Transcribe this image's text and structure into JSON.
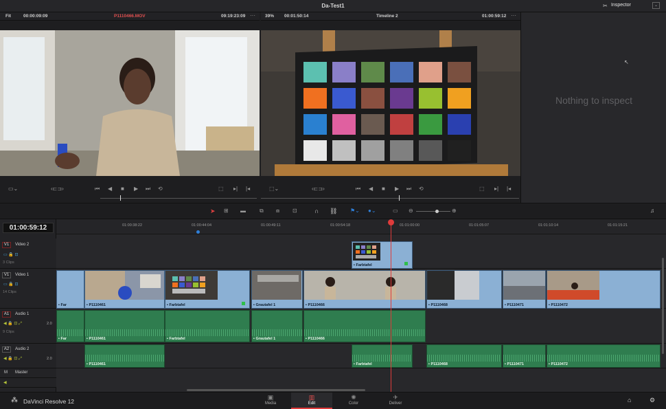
{
  "app": {
    "title": "Da-Test1",
    "inspector_label": "Inspector",
    "brand": "DaVinci Resolve 12"
  },
  "source_viewer": {
    "zoom": "Fit",
    "timecode_in": "00:00:09:09",
    "clip_name": "P1110466.MOV",
    "timecode_out": "09:19:23:09"
  },
  "timeline_viewer": {
    "zoom": "39%",
    "timecode_in": "00:01:50:14",
    "timeline_name": "Timeline 2",
    "timecode_out": "01:00:59:12"
  },
  "inspector": {
    "empty_text": "Nothing to inspect"
  },
  "timeline": {
    "current_timecode": "01:00:59:12",
    "ruler": [
      "01:00:38:22",
      "01:00:44:04",
      "01:00:49:11",
      "01:00:54:18",
      "01:01:00:00",
      "01:01:05:07",
      "01:01:10:14",
      "01:01:15:21"
    ],
    "tracks": {
      "v2": {
        "id": "V1",
        "name": "Video 2",
        "clips": "3 Clips"
      },
      "v1": {
        "id": "V1",
        "name": "Video 1",
        "clips": "14 Clips"
      },
      "a1": {
        "id": "A1",
        "name": "Audio 1",
        "clips": "9 Clips",
        "level": "2.0"
      },
      "a2": {
        "id": "A2",
        "name": "Audio 2",
        "level": "2.0"
      },
      "master": {
        "id": "M",
        "name": "Master"
      }
    },
    "video2_clips": [
      {
        "label": "Farbtafel"
      }
    ],
    "video1_clips": [
      {
        "label": "Far"
      },
      {
        "label": "P1110461"
      },
      {
        "label": "Farbtafel"
      },
      {
        "label": "Grautafel 1"
      },
      {
        "label": "P1110466"
      },
      {
        "label": "P1110468"
      },
      {
        "label": "P1110471"
      },
      {
        "label": "P1110472"
      }
    ],
    "audio1_clips": [
      {
        "label": "Far"
      },
      {
        "label": "P1110461"
      },
      {
        "label": "Farbtafel"
      },
      {
        "label": "Grautafel 1"
      },
      {
        "label": "P1110466"
      }
    ],
    "audio2_clips": [
      {
        "label": "P1110461"
      },
      {
        "label": "Farbtafel"
      },
      {
        "label": "P1110468"
      },
      {
        "label": "P1110471"
      },
      {
        "label": "P1110472"
      }
    ]
  },
  "pages": {
    "media": "Media",
    "edit": "Edit",
    "color": "Color",
    "deliver": "Deliver"
  },
  "colors": {
    "accent": "#e03b3b",
    "video_clip": "#8bb0d4",
    "audio_clip": "#2f7d4f"
  }
}
